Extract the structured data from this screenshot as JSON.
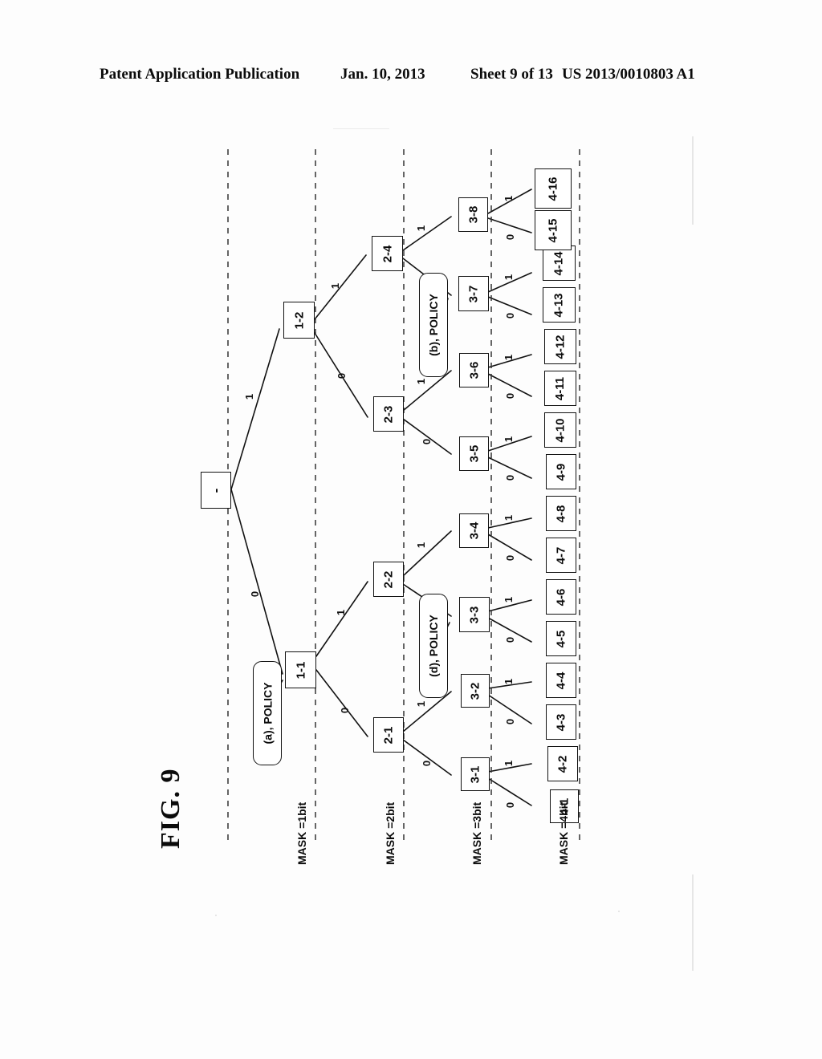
{
  "header": {
    "publication": "Patent Application Publication",
    "date": "Jan. 10, 2013",
    "sheet": "Sheet 9 of 13",
    "number": "US 2013/0010803 A1"
  },
  "figure": {
    "label": "FIG. 9",
    "orientation": "rotated-90-ccw",
    "description": "Binary trie showing prefix expansion by MASK length with policy annotations"
  },
  "mask_columns": [
    {
      "id": "mask1",
      "label": "MASK =1bit"
    },
    {
      "id": "mask2",
      "label": "MASK =2bit"
    },
    {
      "id": "mask3",
      "label": "MASK =3bit"
    },
    {
      "id": "mask4",
      "label": "MASK =4bit"
    }
  ],
  "nodes": {
    "root": {
      "id": "root",
      "label": "-"
    },
    "level1": [
      {
        "id": "n1-1",
        "label": "1-1"
      },
      {
        "id": "n1-2",
        "label": "1-2"
      }
    ],
    "level2": [
      {
        "id": "n2-1",
        "label": "2-1"
      },
      {
        "id": "n2-2",
        "label": "2-2"
      },
      {
        "id": "n2-3",
        "label": "2-3"
      },
      {
        "id": "n2-4",
        "label": "2-4"
      }
    ],
    "level3": [
      {
        "id": "n3-1",
        "label": "3-1"
      },
      {
        "id": "n3-2",
        "label": "3-2"
      },
      {
        "id": "n3-3",
        "label": "3-3"
      },
      {
        "id": "n3-4",
        "label": "3-4"
      },
      {
        "id": "n3-5",
        "label": "3-5"
      },
      {
        "id": "n3-6",
        "label": "3-6"
      },
      {
        "id": "n3-7",
        "label": "3-7"
      },
      {
        "id": "n3-8",
        "label": "3-8"
      }
    ],
    "level4": [
      {
        "id": "n4-1",
        "label": "4-1"
      },
      {
        "id": "n4-2",
        "label": "4-2"
      },
      {
        "id": "n4-3",
        "label": "4-3"
      },
      {
        "id": "n4-4",
        "label": "4-4"
      },
      {
        "id": "n4-5",
        "label": "4-5"
      },
      {
        "id": "n4-6",
        "label": "4-6"
      },
      {
        "id": "n4-7",
        "label": "4-7"
      },
      {
        "id": "n4-8",
        "label": "4-8"
      },
      {
        "id": "n4-9",
        "label": "4-9"
      },
      {
        "id": "n4-10",
        "label": "4-10"
      },
      {
        "id": "n4-11",
        "label": "4-11"
      },
      {
        "id": "n4-12",
        "label": "4-12"
      },
      {
        "id": "n4-13",
        "label": "4-13"
      },
      {
        "id": "n4-14",
        "label": "4-14"
      },
      {
        "id": "n4-15",
        "label": "4-15"
      },
      {
        "id": "n4-16",
        "label": "4-16"
      }
    ]
  },
  "edge_labels": {
    "bit_one": "1",
    "bit_zero": "0",
    "edges": [
      {
        "from": "root",
        "to": "n1-2",
        "label": "1"
      },
      {
        "from": "root",
        "to": "n1-1",
        "label": "0"
      },
      {
        "from": "n1-2",
        "to": "n2-4",
        "label": "1"
      },
      {
        "from": "n1-2",
        "to": "n2-3",
        "label": "0"
      },
      {
        "from": "n1-1",
        "to": "n2-2",
        "label": "1"
      },
      {
        "from": "n1-1",
        "to": "n2-1",
        "label": "0"
      },
      {
        "from": "n2-4",
        "to": "n3-8",
        "label": "1"
      },
      {
        "from": "n2-4",
        "to": "n3-7",
        "label": "0"
      },
      {
        "from": "n2-3",
        "to": "n3-6",
        "label": "1"
      },
      {
        "from": "n2-3",
        "to": "n3-5",
        "label": "0"
      },
      {
        "from": "n2-2",
        "to": "n3-4",
        "label": "1"
      },
      {
        "from": "n2-2",
        "to": "n3-3",
        "label": "0"
      },
      {
        "from": "n2-1",
        "to": "n3-2",
        "label": "1"
      },
      {
        "from": "n2-1",
        "to": "n3-1",
        "label": "0"
      },
      {
        "from": "n3-8",
        "to": "n4-16",
        "label": "1"
      },
      {
        "from": "n3-8",
        "to": "n4-15",
        "label": "0"
      },
      {
        "from": "n3-7",
        "to": "n4-14",
        "label": "1"
      },
      {
        "from": "n3-7",
        "to": "n4-13",
        "label": "0"
      },
      {
        "from": "n3-6",
        "to": "n4-12",
        "label": "1"
      },
      {
        "from": "n3-6",
        "to": "n4-11",
        "label": "0"
      },
      {
        "from": "n3-5",
        "to": "n4-10",
        "label": "1"
      },
      {
        "from": "n3-5",
        "to": "n4-9",
        "label": "0"
      },
      {
        "from": "n3-4",
        "to": "n4-8",
        "label": "1"
      },
      {
        "from": "n3-4",
        "to": "n4-7",
        "label": "0"
      },
      {
        "from": "n3-3",
        "to": "n4-6",
        "label": "1"
      },
      {
        "from": "n3-3",
        "to": "n4-5",
        "label": "0"
      },
      {
        "from": "n3-2",
        "to": "n4-4",
        "label": "1"
      },
      {
        "from": "n3-2",
        "to": "n4-3",
        "label": "0"
      },
      {
        "from": "n3-1",
        "to": "n4-2",
        "label": "1"
      },
      {
        "from": "n3-1",
        "to": "n4-1",
        "label": "0"
      }
    ]
  },
  "policies": [
    {
      "id": "policy-a",
      "label": "(a), POLICY",
      "target": "n1-1"
    },
    {
      "id": "policy-b",
      "label": "(b), POLICY",
      "target": "n3-7"
    },
    {
      "id": "policy-d",
      "label": "(d), POLICY",
      "target": "n3-3"
    }
  ],
  "colors": {
    "ink": "#111111",
    "page": "#fdfdfd",
    "node_fill": "#ffffff"
  }
}
